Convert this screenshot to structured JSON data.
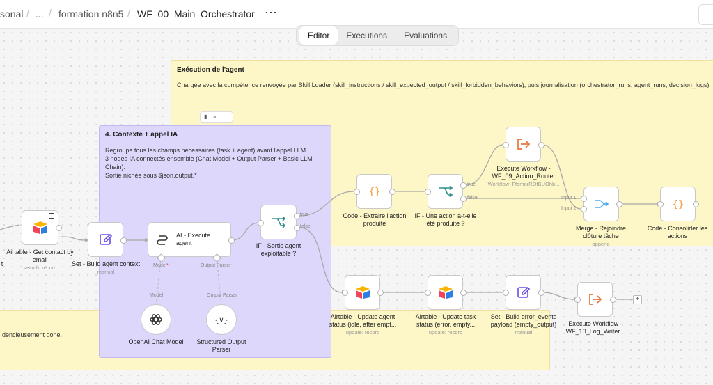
{
  "breadcrumb": {
    "project": "sonal",
    "ellipsis": "...",
    "folder": "formation n8n5",
    "workflow": "WF_00_Main_Orchestrator",
    "more": "⋯"
  },
  "tabs": [
    "Editor",
    "Executions",
    "Evaluations"
  ],
  "colors": {
    "sticky_yellow": "#fdf6c6",
    "sticky_purple": "#dcd7fb",
    "airtable_blue": "#2f7fe2",
    "airtable_red": "#f0455b",
    "airtable_yellow": "#fcb400",
    "set_purple": "#6a4de8",
    "code_orange": "#f09a3c",
    "if_teal": "#2e8f8a",
    "merge_blue": "#4aa8e8",
    "exec_orange": "#e8763b"
  },
  "stickies": {
    "agent": {
      "title": "Exécution de l'agent",
      "text": "Chargée avec la compétence renvoyée par Skill Loader (skill_instructions / skill_expected_output / skill_forbidden_behaviors), puis journalisation (orchestrator_runs, agent_runs, decision_logs)."
    },
    "context": {
      "title": "4. Contexte + appel IA",
      "lines": [
        "Regroupe tous les champs nécessaires (task + agent) avant l'appel LLM.",
        "3 nodes IA connectés ensemble (Chat Model + Output Parser + Basic LLM",
        "Chain).",
        "Sortie nichée sous $json.output.*"
      ]
    },
    "bottom": {
      "text": "dencieusement done."
    }
  },
  "nodes": {
    "airtable_contact": {
      "label": [
        "Airtable - Get contact by",
        "email"
      ],
      "sub": "search: record",
      "icon": "airtable-icon"
    },
    "set_agent_context": {
      "label": [
        "Set - Build agent context"
      ],
      "sub": "manual",
      "icon": "pencil-icon"
    },
    "ai_execute_agent": {
      "label": [
        "AI - Execute",
        "agent"
      ],
      "icon": "chain-icon",
      "port_model": "Model",
      "port_parser": "Output Parser"
    },
    "if_sortie": {
      "label": [
        "IF - Sortie agent",
        "exploitable ?"
      ],
      "icon": "if-branch-icon",
      "true": "true",
      "false": "false"
    },
    "openai_model": {
      "label": [
        "OpenAI Chat Model"
      ],
      "icon": "openai-icon",
      "port": "Model"
    },
    "structured_parser": {
      "label": [
        "Structured Output",
        "Parser"
      ],
      "icon": "braces-icon",
      "port": "Output Parser"
    },
    "code_extraire": {
      "label": [
        "Code - Extraire l'action",
        "produite"
      ],
      "icon": "code-braces-icon"
    },
    "if_action": {
      "label": [
        "IF - Une action a-t-elle",
        "été produite ?"
      ],
      "icon": "if-branch-icon",
      "true": "true",
      "false": "false"
    },
    "exec_action_router": {
      "label": [
        "Execute Workflow -",
        "WF_09_Action_Router"
      ],
      "sub": "Workflow: FfdmorROfBUOhb...",
      "icon": "exec-arrow-icon"
    },
    "merge_cloture": {
      "label": [
        "Merge - Rejoindre",
        "clôture tâche"
      ],
      "sub": "append",
      "icon": "merge-icon",
      "in1": "Input 1",
      "in2": "Input 2"
    },
    "code_consolider": {
      "label": [
        "Code - Consolider les",
        "actions"
      ],
      "icon": "code-braces-icon"
    },
    "airtable_agent_status": {
      "label": [
        "Airtable - Update agent",
        "status (idle, after empt..."
      ],
      "sub": "update: record",
      "icon": "airtable-icon"
    },
    "airtable_task_status": {
      "label": [
        "Airtable - Update task",
        "status (error, empty..."
      ],
      "sub": "update: record",
      "icon": "airtable-icon"
    },
    "set_error_events": {
      "label": [
        "Set - Build error_events",
        "payload (empty_output)"
      ],
      "sub": "manual",
      "icon": "pencil-icon"
    },
    "exec_log_writer": {
      "label": [
        "Execute Workflow -",
        "WF_10_Log_Writer..."
      ],
      "icon": "exec-arrow-icon"
    },
    "left_partial_label": "t",
    "add_button": "+"
  },
  "sticky_toolbar": [
    "trash-icon",
    "color-icon",
    "more-icon"
  ]
}
